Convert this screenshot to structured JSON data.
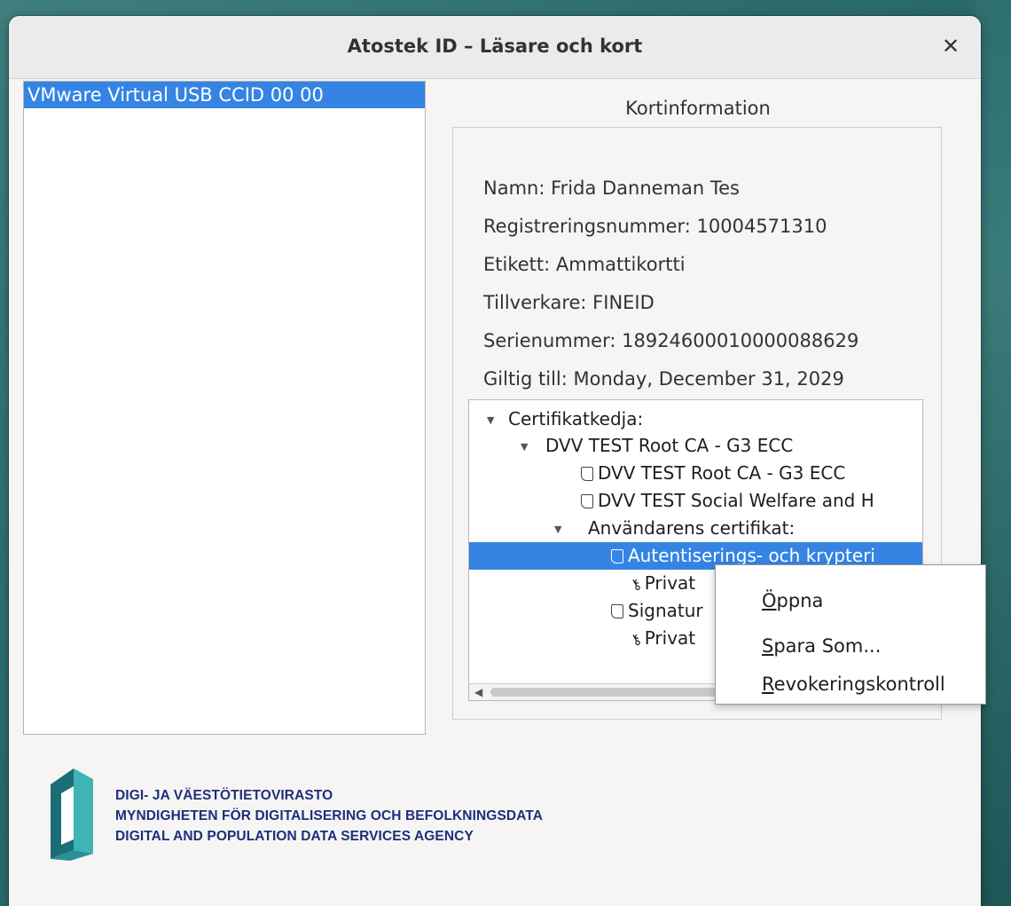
{
  "window": {
    "title": "Atostek ID – Läsare och kort",
    "close_icon": "close-icon"
  },
  "readers": {
    "items": [
      "VMware Virtual USB CCID 00 00"
    ]
  },
  "card": {
    "frame_title": "Kortinformation",
    "name": "Namn: Frida Danneman Tes",
    "registration": "Registreringsnummer: 10004571310",
    "label": "Etikett: Ammattikortti",
    "manufacturer": "Tillverkare: FINEID",
    "serial": "Serienummer: 18924600010000088629",
    "valid_until": "Giltig till: Monday, December 31, 2029"
  },
  "tree": {
    "chain_label": "Certifikatkedja:",
    "root_node": "DVV TEST Root CA - G3 ECC",
    "root_cert": "DVV TEST Root CA - G3 ECC",
    "intermediate_cert": "DVV TEST Social Welfare and H",
    "user_certs_label": "Användarens certifikat:",
    "auth_cert": "Autentiserings- och krypteri",
    "private_key_1": "Privat",
    "sign_cert": "Signatur",
    "private_key_2": "Privat"
  },
  "context_menu": {
    "open_first": "Ö",
    "open_rest": "ppna",
    "save_first": "S",
    "save_rest": "para Som...",
    "revoke_first": "R",
    "revoke_rest": "evokeringskontroll"
  },
  "organization": {
    "line1": "DIGI- JA VÄESTÖTIETOVIRASTO",
    "line2": "MYNDIGHETEN FÖR DIGITALISERING OCH BEFOLKNINGSDATA",
    "line3": "DIGITAL AND POPULATION DATA SERVICES AGENCY"
  },
  "colors": {
    "selection": "#3584e4",
    "logo_dark": "#1b6d78",
    "logo_light": "#3fb4b4",
    "org_text": "#1d2f7a"
  }
}
